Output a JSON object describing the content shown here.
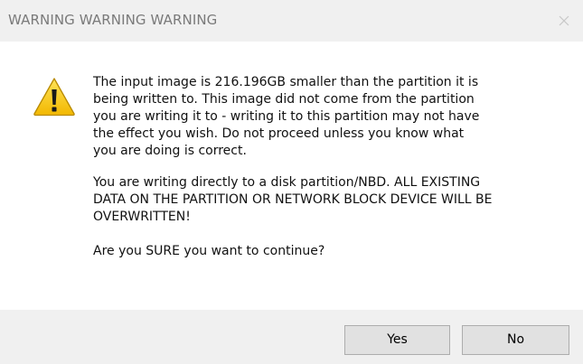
{
  "window": {
    "title": "WARNING  WARNING  WARNING"
  },
  "message": {
    "paragraph1": "The input image is 216.196GB smaller than the partition it is\nbeing written to.  This image did not come from the partition\nyou are writing it to - writing it to this partition may not have\nthe effect you wish.  Do not proceed unless you know what\nyou are doing is correct.",
    "paragraph2": "You are writing directly to a disk partition/NBD.  ALL EXISTING\nDATA ON THE PARTITION OR NETWORK BLOCK DEVICE WILL BE\nOVERWRITTEN!",
    "paragraph3": "Are you SURE you want to continue?"
  },
  "buttons": {
    "yes_label": "Yes",
    "no_label": "No"
  },
  "icons": {
    "warning": "warning-icon",
    "close": "close-icon"
  },
  "colors": {
    "warning_fill": "#f5c400",
    "titlebar_bg": "#f0f0f0",
    "button_bg": "#e1e1e1"
  }
}
